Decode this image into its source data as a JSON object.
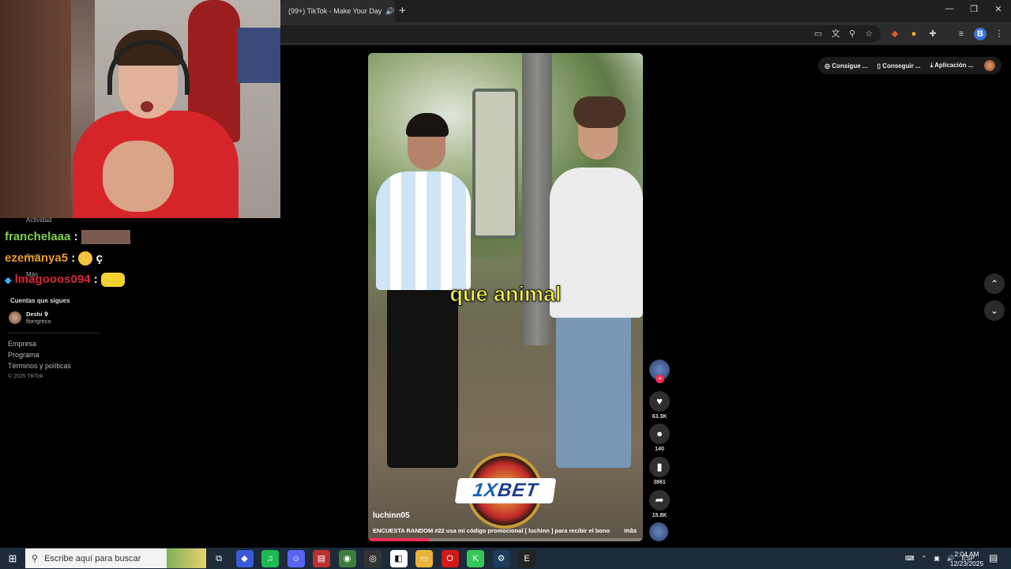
{
  "browser": {
    "tab_title": "(99+) TikTok - Make Your Day",
    "tab_mute_glyph": "🔊",
    "close_glyph": "✕",
    "new_tab_glyph": "+",
    "window_controls": [
      "—",
      "❐",
      "✕"
    ],
    "toolbar_icons": [
      "cast-icon",
      "translate-icon",
      "zoom-icon",
      "star-icon",
      "extension-icon",
      "chrome-icon",
      "puzzle-icon",
      "reading-list-icon",
      "profile-icon",
      "menu-icon"
    ],
    "profile_initial": "B"
  },
  "chat": {
    "lines": [
      {
        "user": "franchelaaa",
        "sep": ":",
        "text": "",
        "color": "#7fd34a"
      },
      {
        "user": "ezemanya5",
        "sep": ":",
        "text": "ç",
        "color": "#e89a27"
      },
      {
        "user": "lmagooos094",
        "sep": ":",
        "text": "",
        "color": "#d8263b"
      }
    ],
    "overlay_labels": [
      "Actividad",
      "Perfil",
      "Más"
    ]
  },
  "sidebar": {
    "following_heading": "Cuentas que sigues",
    "following": [
      {
        "name": "Deshi ✞",
        "handle": "florrgreco"
      }
    ],
    "footer_links": [
      "Empresa",
      "Programa",
      "Términos y políticas"
    ],
    "copyright": "© 2025 TikTok"
  },
  "topbar": {
    "items": [
      {
        "icon": "coin-icon",
        "label": "Consigue ..."
      },
      {
        "icon": "phone-icon",
        "label": "Conseguir ..."
      },
      {
        "icon": "download-icon",
        "label": "Aplicación ..."
      }
    ]
  },
  "video": {
    "caption": "que animal",
    "ad_logo_one": "1X",
    "ad_logo_bet": "BET",
    "author": "luchinn05",
    "description": "ENCUESTA RANDOM #22 usa mi código promocional [ luchinn ] para recibir el bono--",
    "more_label": "más",
    "progress": 0.22
  },
  "actions": {
    "likes": "63.3K",
    "comments": "140",
    "saves": "3861",
    "shares": "15.8K",
    "follow_glyph": "+"
  },
  "nav": {
    "up": "⌃",
    "down": "⌄"
  },
  "taskbar": {
    "search_placeholder": "Escribe aquí para buscar",
    "language": "ESP",
    "time": "2:04 AM",
    "date": "12/23/2025",
    "apps": [
      {
        "name": "task-view",
        "color": "#1c2a3a",
        "glyph": "⧉"
      },
      {
        "name": "copilot",
        "color": "#3a5bd8",
        "glyph": "◆"
      },
      {
        "name": "spotify",
        "color": "#1db954",
        "glyph": "♫"
      },
      {
        "name": "discord",
        "color": "#5865f2",
        "glyph": "☺"
      },
      {
        "name": "voice-app",
        "color": "#b83030",
        "glyph": "▤"
      },
      {
        "name": "chrome",
        "color": "#3c7d3c",
        "glyph": "◉"
      },
      {
        "name": "obs",
        "color": "#333",
        "glyph": "◎"
      },
      {
        "name": "capcut",
        "color": "#fff",
        "glyph": "◧"
      },
      {
        "name": "explorer",
        "color": "#e7b53b",
        "glyph": "▭"
      },
      {
        "name": "opera",
        "color": "#d11a1a",
        "glyph": "O"
      },
      {
        "name": "kick",
        "color": "#35c759",
        "glyph": "K"
      },
      {
        "name": "steam",
        "color": "#1b3a5c",
        "glyph": "⚙"
      },
      {
        "name": "epic-games",
        "color": "#222",
        "glyph": "E"
      }
    ]
  }
}
